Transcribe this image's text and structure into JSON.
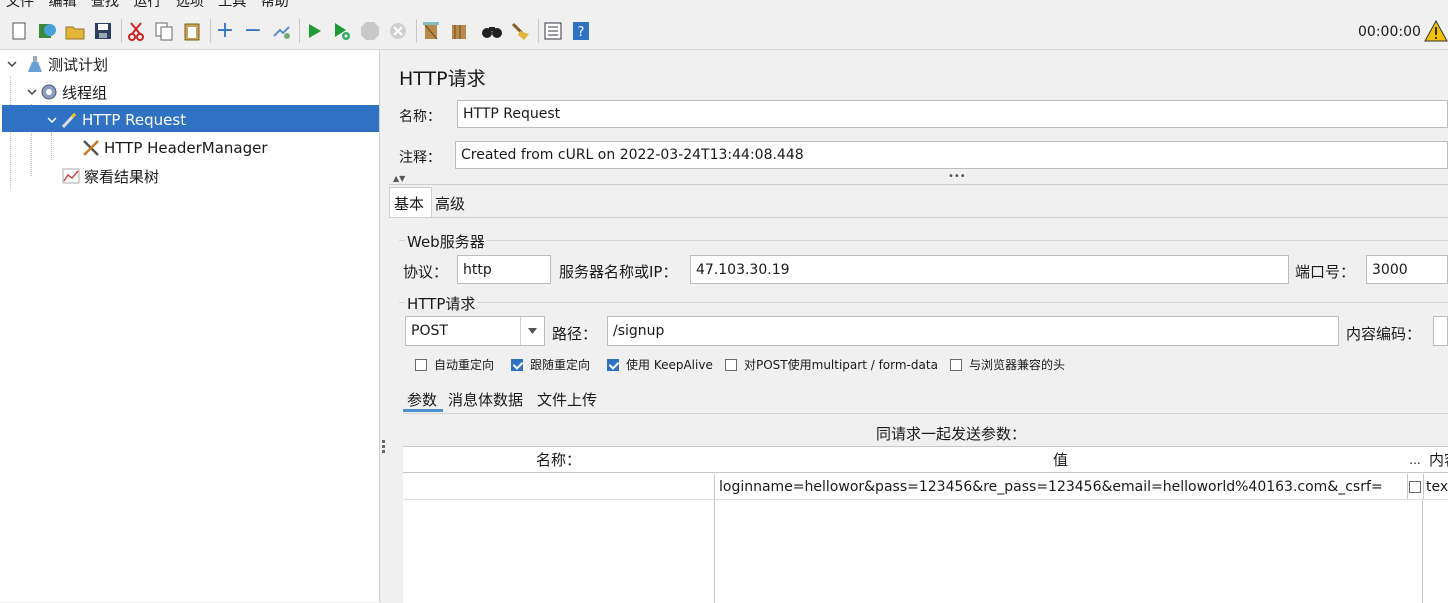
{
  "menu": {
    "items": [
      "文件",
      "编辑",
      "查找",
      "运行",
      "选项",
      "工具",
      "帮助"
    ]
  },
  "toolbar": {
    "timer": "00:00:00",
    "icons": [
      "new-icon",
      "templates-icon",
      "open-icon",
      "save-icon",
      "cut-icon",
      "copy-icon",
      "paste-icon",
      "expand-icon",
      "collapse-icon",
      "toggle-icon",
      "start-icon",
      "start-no-pause-icon",
      "stop-icon",
      "shutdown-icon",
      "clear-icon",
      "clear-all-icon",
      "search-icon",
      "reset-search-icon",
      "function-helper-icon",
      "help-icon",
      "warning-icon"
    ]
  },
  "tree": {
    "nodes": [
      {
        "label": "测试计划",
        "icon": "flask-icon"
      },
      {
        "label": "线程组",
        "icon": "gear-icon"
      },
      {
        "label": "HTTP Request",
        "icon": "pipette-icon",
        "selected": true
      },
      {
        "label": "HTTP HeaderManager",
        "icon": "tools-icon"
      },
      {
        "label": "察看结果树",
        "icon": "graph-icon"
      }
    ]
  },
  "panel": {
    "title": "HTTP请求",
    "name_label": "名称：",
    "name_value": "HTTP Request",
    "comment_label": "注释：",
    "comment_value": "Created from cURL on 2022-03-24T13:44:08.448",
    "tabs": [
      "基本",
      "高级"
    ],
    "web_server": {
      "group_label": "Web服务器",
      "protocol_label": "协议：",
      "protocol_value": "http",
      "server_label": "服务器名称或IP：",
      "server_value": "47.103.30.19",
      "port_label": "端口号：",
      "port_value": "3000"
    },
    "http_request": {
      "group_label": "HTTP请求",
      "method": "POST",
      "path_label": "路径：",
      "path_value": "/signup",
      "encoding_label": "内容编码："
    },
    "options": [
      {
        "label": "自动重定向",
        "checked": false
      },
      {
        "label": "跟随重定向",
        "checked": true
      },
      {
        "label": "使用 KeepAlive",
        "checked": true
      },
      {
        "label": "对POST使用multipart / form-data",
        "checked": false
      },
      {
        "label": "与浏览器兼容的头",
        "checked": false
      }
    ],
    "sub_tabs": [
      "参数",
      "消息体数据",
      "文件上传"
    ],
    "params_caption": "同请求一起发送参数：",
    "table": {
      "headers": [
        "名称：",
        "值",
        "...",
        "内容"
      ],
      "rows": [
        {
          "name": "",
          "value": "loginname=hellowor&pass=123456&re_pass=123456&email=helloworld%40163.com&_csrf=",
          "encode": false,
          "content": "tex"
        }
      ]
    }
  }
}
